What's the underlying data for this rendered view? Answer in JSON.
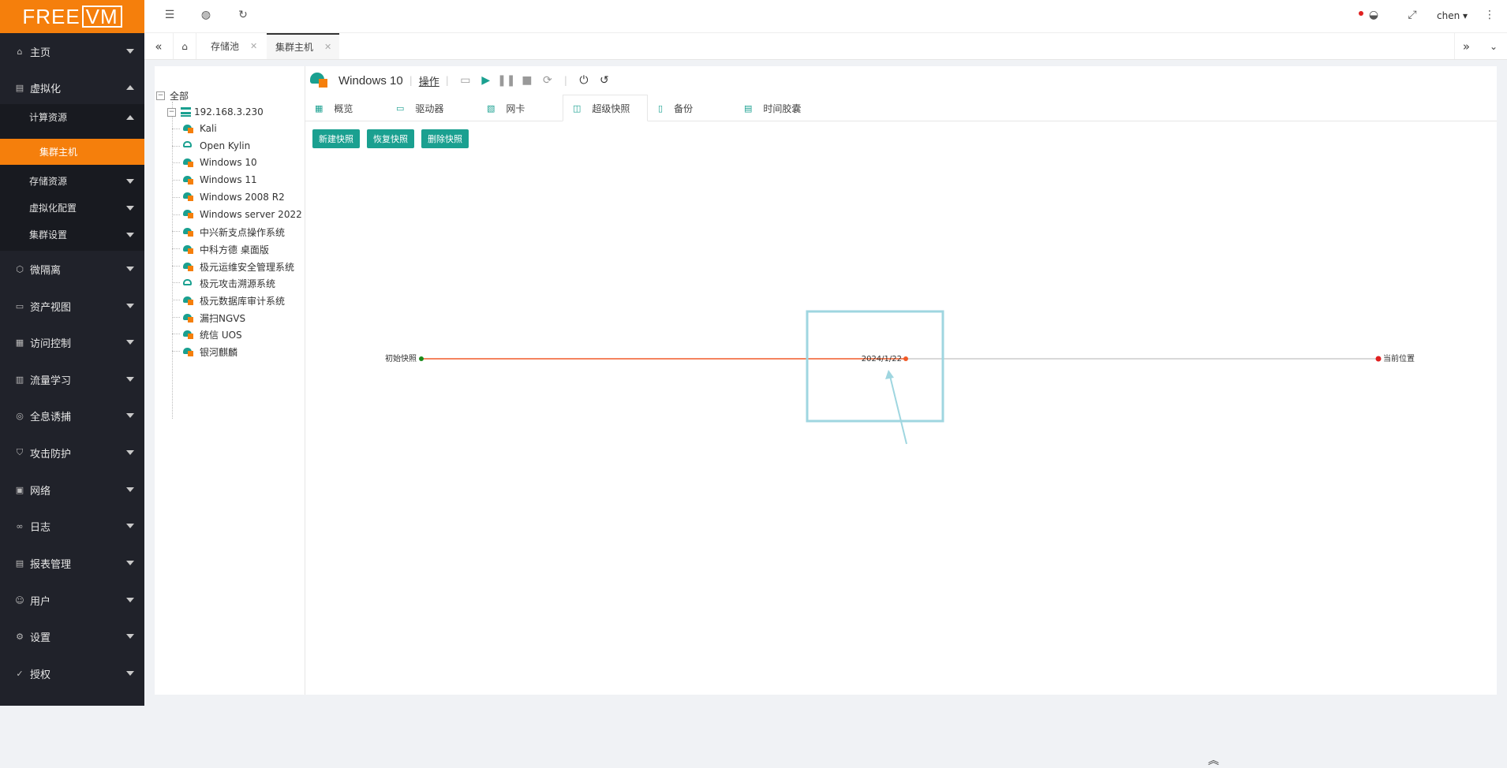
{
  "logo": {
    "text_a": "FREE",
    "text_b": "VM"
  },
  "sidebar": {
    "items": [
      {
        "label": "主页",
        "icon": "home-icon"
      },
      {
        "label": "虚拟化",
        "icon": "virtualization-icon"
      },
      {
        "label": "微隔离",
        "icon": "cube-icon"
      },
      {
        "label": "资产视图",
        "icon": "asset-icon"
      },
      {
        "label": "访问控制",
        "icon": "access-icon"
      },
      {
        "label": "流量学习",
        "icon": "traffic-icon"
      },
      {
        "label": "全息诱捕",
        "icon": "trap-icon"
      },
      {
        "label": "攻击防护",
        "icon": "shield-icon"
      },
      {
        "label": "网络",
        "icon": "network-icon"
      },
      {
        "label": "日志",
        "icon": "log-icon"
      },
      {
        "label": "报表管理",
        "icon": "report-icon"
      },
      {
        "label": "用户",
        "icon": "user-icon"
      },
      {
        "label": "设置",
        "icon": "gear-icon"
      },
      {
        "label": "授权",
        "icon": "license-icon"
      }
    ],
    "sub": {
      "compute": "计算资源",
      "cluster_host": "集群主机",
      "storage": "存储资源",
      "virt_config": "虚拟化配置",
      "cluster_settings": "集群设置"
    }
  },
  "topbar": {
    "user": "chen"
  },
  "tabs": [
    {
      "label": "存储池"
    },
    {
      "label": "集群主机"
    }
  ],
  "tree": {
    "root": "全部",
    "host": "192.168.3.230",
    "vms": [
      "Kali",
      "Open Kylin",
      "Windows 10",
      "Windows 11",
      "Windows 2008 R2",
      "Windows server 2022",
      "中兴新支点操作系统",
      "中科方德 桌面版",
      "极元运维安全管理系统",
      "极元攻击溯源系统",
      "极元数据库审计系统",
      "漏扫NGVS",
      "统信 UOS",
      "银河麒麟"
    ]
  },
  "vm": {
    "title": "Windows 10",
    "op": "操作"
  },
  "subtabs": [
    {
      "label": "概览",
      "icon": "grid-icon"
    },
    {
      "label": "驱动器",
      "icon": "drive-icon"
    },
    {
      "label": "网卡",
      "icon": "nic-icon"
    },
    {
      "label": "超级快照",
      "icon": "camera-icon"
    },
    {
      "label": "备份",
      "icon": "backup-icon"
    },
    {
      "label": "时间胶囊",
      "icon": "capsule-icon"
    }
  ],
  "buttons": {
    "new": "新建快照",
    "restore": "恢复快照",
    "delete": "删除快照"
  },
  "timeline": {
    "start_label": "初始快照",
    "snapshot_label": "2024/1/22",
    "current_label": "当前位置",
    "colors": {
      "active": "#f05a28",
      "inactive": "#cccccc",
      "start": "#1a8a1a",
      "current": "#e02020"
    }
  },
  "colors": {
    "accent": "#f57f0c",
    "teal": "#1aa090",
    "sidebar": "#20222a"
  }
}
